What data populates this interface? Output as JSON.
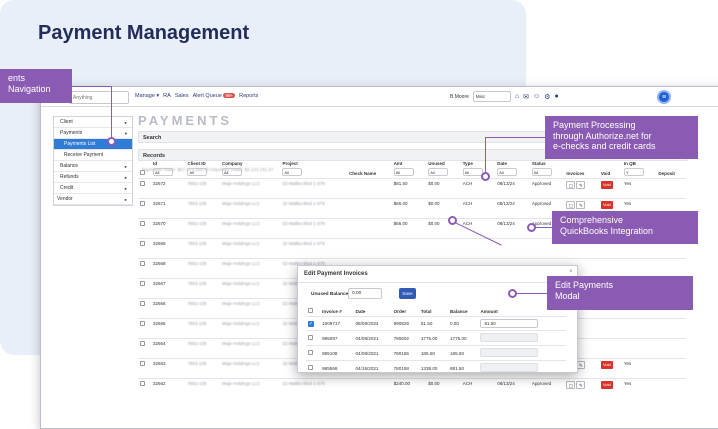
{
  "page": {
    "title": "Payment Management"
  },
  "topbar": {
    "search_placeholder": "Anything",
    "nav": [
      "Manage ▾",
      "RA",
      "Sales",
      "Alert Queue",
      "Reports"
    ],
    "alert_badge": "99+",
    "user": "B.Moore",
    "select_value": "Misc"
  },
  "sidebar": {
    "items": [
      {
        "label": "Client",
        "caret": "▸"
      },
      {
        "label": "Payments",
        "caret": "▾"
      },
      {
        "label": "Payments List",
        "caret": ""
      },
      {
        "label": "Receive Payment",
        "caret": ""
      },
      {
        "label": "Balance",
        "caret": "▸"
      },
      {
        "label": "Refunds",
        "caret": "▸"
      },
      {
        "label": "Credit",
        "caret": "▸"
      },
      {
        "label": "Vendor",
        "caret": "▸"
      }
    ]
  },
  "main": {
    "heading": "PAYMENTS",
    "search_bar": "Search",
    "records_bar": "Records",
    "totals": "Payments Totals: $67,471,354.38     Unposted Totals: $2,123,741.37",
    "columns": [
      "Id",
      "Client ID",
      "Company",
      "Project",
      "Check Name",
      "Amt",
      "Unused",
      "Type",
      "Date",
      "Status",
      "Invoices",
      "Void",
      "In QB",
      "Deposit"
    ],
    "filters": [
      "All",
      "All",
      "All",
      "All",
      "",
      "All",
      "All",
      "All",
      "All",
      "All",
      "",
      "",
      "Y",
      ""
    ],
    "rows": [
      {
        "id": "32672",
        "client": "7952-135",
        "company": "Maje Holdings LLC",
        "project": "32 Malibu Blvd 1-979",
        "amt": "$81.50",
        "unused": "$0.00",
        "type": "ACH",
        "date": "08/13/24",
        "status": "Approved",
        "inqb": "Yes"
      },
      {
        "id": "32671",
        "client": "7952-135",
        "company": "Maje Holdings LLC",
        "project": "32 Malibu Blvd 1-979",
        "amt": "$66.00",
        "unused": "$0.00",
        "type": "ACH",
        "date": "08/13/24",
        "status": "Approved",
        "inqb": "Yes"
      },
      {
        "id": "32670",
        "client": "7952-135",
        "company": "Maje Holdings LLC",
        "project": "32 Malibu Blvd 1-979",
        "amt": "$66.00",
        "unused": "$0.00",
        "type": "ACH",
        "date": "08/13/24",
        "status": "Approved",
        "inqb": "Yes"
      },
      {
        "id": "32669",
        "client": "7952-135",
        "company": "Maje Holdings LLC",
        "project": "32 Malibu Blvd 1-979",
        "amt": "",
        "unused": "",
        "type": "",
        "date": "",
        "status": "",
        "inqb": ""
      },
      {
        "id": "32668",
        "client": "7952-135",
        "company": "Maje Holdings LLC",
        "project": "32 Malibu Blvd 1-979",
        "amt": "",
        "unused": "",
        "type": "",
        "date": "",
        "status": "",
        "inqb": ""
      },
      {
        "id": "32667",
        "client": "7952-135",
        "company": "Maje Holdings LLC",
        "project": "32 Malibu Blvd 1-979",
        "amt": "",
        "unused": "",
        "type": "",
        "date": "",
        "status": "",
        "inqb": ""
      },
      {
        "id": "32666",
        "client": "7952-135",
        "company": "Maje Holdings LLC",
        "project": "32 Malibu Blvd 1-979",
        "amt": "",
        "unused": "",
        "type": "",
        "date": "",
        "status": "",
        "inqb": ""
      },
      {
        "id": "32665",
        "client": "7952-135",
        "company": "Maje Holdings LLC",
        "project": "32 Malibu Blvd 1-979",
        "amt": "",
        "unused": "",
        "type": "",
        "date": "",
        "status": "",
        "inqb": ""
      },
      {
        "id": "32664",
        "client": "7952-135",
        "company": "Maje Holdings LLC",
        "project": "32 Malibu Blvd 1-979",
        "amt": "",
        "unused": "",
        "type": "",
        "date": "",
        "status": "",
        "inqb": ""
      },
      {
        "id": "32663",
        "client": "7952-135",
        "company": "Maje Holdings LLC",
        "project": "32 Malibu Blvd 1-979",
        "amt": "$240.00",
        "unused": "$0.00",
        "type": "ACH",
        "date": "08/13/24",
        "status": "Approved",
        "inqb": "Yes"
      },
      {
        "id": "32662",
        "client": "7952-135",
        "company": "Maje Holdings LLC",
        "project": "32 Malibu Blvd 1-979",
        "amt": "$240.00",
        "unused": "$0.00",
        "type": "ACH",
        "date": "08/13/24",
        "status": "Approved",
        "inqb": "Yes"
      }
    ],
    "void_label": "Void"
  },
  "modal": {
    "title": "Edit Payment Invoices",
    "close": "×",
    "unused_balance_label": "Unused Balance",
    "unused_balance_value": "0.00",
    "save_label": "Save",
    "columns": [
      "",
      "Invoice #",
      "Date",
      "Order",
      "Total",
      "Balance",
      "Amount"
    ],
    "rows": [
      {
        "checked": true,
        "invoice": "1009717",
        "date": "08/09/2024",
        "order": "990829",
        "total": "81.50",
        "balance": "0.00",
        "amount": "81.50"
      },
      {
        "checked": false,
        "invoice": "985097",
        "date": "04/08/2021",
        "order": "780602",
        "total": "1775.00",
        "balance": "1775.00",
        "amount": ""
      },
      {
        "checked": false,
        "invoice": "985108",
        "date": "04/08/2021",
        "order": "780155",
        "total": "185.50",
        "balance": "185.50",
        "amount": ""
      },
      {
        "checked": false,
        "invoice": "985566",
        "date": "04/15/2021",
        "order": "780158",
        "total": "1338.00",
        "balance": "881.50",
        "amount": ""
      }
    ]
  },
  "callouts": {
    "navigation": "ents\nNavigation",
    "processing": "Payment Processing\nthrough Authorize.net for\ne-checks and credit cards",
    "quickbooks": "Comprehensive\nQuickBooks Integration",
    "modal": "Edit Payments\nModal"
  },
  "colors": {
    "accent": "#8a5bb3",
    "title": "#232d5a",
    "primary": "#2e7bd8",
    "void": "#d9342b"
  }
}
